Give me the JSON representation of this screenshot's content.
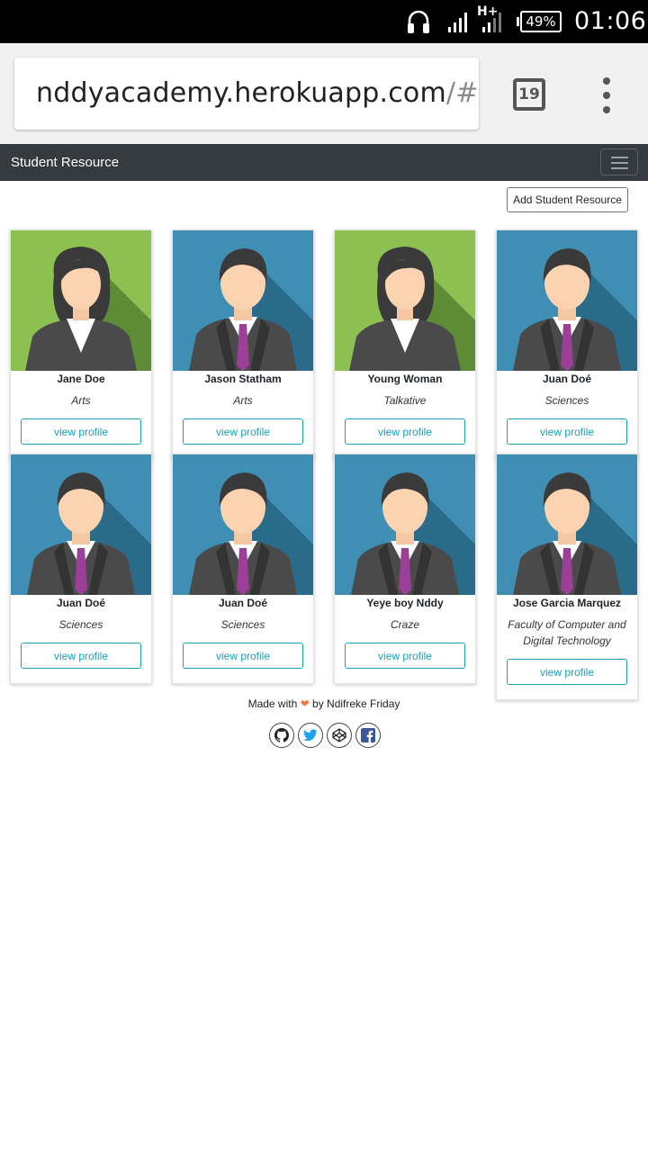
{
  "status_bar": {
    "network": "H+",
    "battery": "49%",
    "time": "01:06"
  },
  "browser": {
    "url_host": "nddyacademy.herokuapp.com",
    "url_path": "/#/",
    "tab_count": "19"
  },
  "navbar": {
    "brand": "Student Resource"
  },
  "add_button_label": "Add Student Resource",
  "view_profile_label": "view profile",
  "students": [
    {
      "name": "Jane Doe",
      "department": "Arts",
      "avatar": "female-avatar-icon"
    },
    {
      "name": "Jason Statham",
      "department": "Arts",
      "avatar": "male-avatar-icon"
    },
    {
      "name": "Young Woman",
      "department": "Talkative",
      "avatar": "female-avatar-icon"
    },
    {
      "name": "Juan Doé",
      "department": "Sciences",
      "avatar": "male-avatar-icon"
    },
    {
      "name": "Juan Doé",
      "department": "Sciences",
      "avatar": "male-avatar-icon"
    },
    {
      "name": "Juan Doé",
      "department": "Sciences",
      "avatar": "male-avatar-icon"
    },
    {
      "name": "Yeye boy Nddy",
      "department": "Craze",
      "avatar": "male-avatar-icon"
    },
    {
      "name": "Jose Garcia Marquez",
      "department": "Faculty of Computer and Digital Technology",
      "avatar": "male-avatar-icon"
    }
  ],
  "footer": {
    "made_with": "Made with",
    "by_text": "by Ndifreke Friday",
    "heart_color": "#ef7b3e",
    "social_icons": [
      "github-icon",
      "twitter-icon",
      "codepen-icon",
      "facebook-icon"
    ]
  },
  "colors": {
    "navbar_bg": "#343a40",
    "accent_info": "#17a2b8",
    "male_avatar_bg": "#3f8eb3",
    "female_avatar_bg": "#8cc152"
  }
}
